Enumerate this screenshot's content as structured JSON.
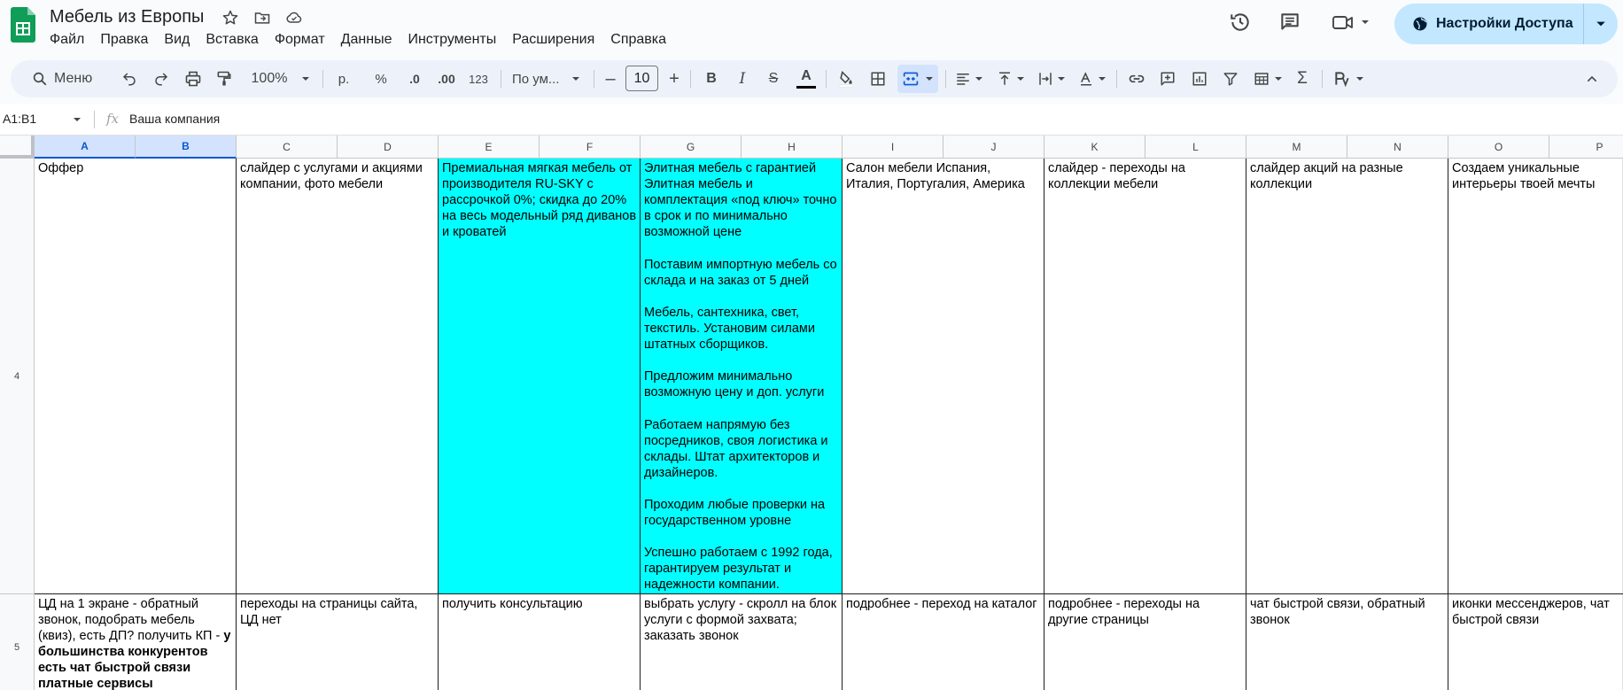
{
  "app": {
    "title": "Мебель из Европы",
    "menu": [
      "Файл",
      "Правка",
      "Вид",
      "Вставка",
      "Формат",
      "Данные",
      "Инструменты",
      "Расширения",
      "Справка"
    ],
    "share_label": "Настройки Доступа"
  },
  "toolbar": {
    "search_label": "Меню",
    "zoom": "100%",
    "currency": "р.",
    "percent": "%",
    "dec_decrease": ".0",
    "dec_increase": ".00",
    "number_format": "123",
    "font_name": "По ум...",
    "font_size": "10",
    "minus": "–",
    "plus": "+",
    "bold": "B",
    "italic": "I",
    "strike": "S",
    "text_color_letter": "A",
    "sum": "Σ"
  },
  "formula_bar": {
    "name_box": "A1:B1",
    "fx": "fx",
    "content": "Ваша компания"
  },
  "colors": {
    "highlight_cyan": "#00ffff",
    "share_bg": "#c2e7ff",
    "selected_header": "#d3e3fd",
    "accent_blue": "#0b57d0",
    "sheets_green": "#0f9d58"
  },
  "columns": [
    "A",
    "B",
    "C",
    "D",
    "E",
    "F",
    "G",
    "H",
    "I",
    "J",
    "K",
    "L",
    "M",
    "N",
    "O",
    "P"
  ],
  "rows": [
    {
      "number": "4",
      "cells": [
        {
          "text": "Оффер",
          "bold_text": ""
        },
        {
          "text": "слайдер с услугами и акциями компании, фото мебели",
          "bold_text": ""
        },
        {
          "text": "Премиальная мягкая мебель от производителя RU-SKY с рассрочкой 0%; скидка до 20% на весь модельный ряд диванов и кроватей",
          "bold_text": ""
        },
        {
          "text": "Элитная мебель с гарантией\nЭлитная мебель и комплектация «под ключ» точно в срок и по минимально возможной цене\n\nПоставим импортную мебель со склада и на заказ от 5 дней\n\nМебель, сантехника, свет, текстиль. Установим силами штатных сборщиков.\n\nПредложим минимально возможную цену и доп. услуги\n\nРаботаем напрямую без посредников, своя логистика и склады. Штат архитекторов и дизайнеров.\n\nПроходим любые проверки на государственном уровне\n\nУспешно работаем с 1992 года, гарантируем результат и надежности компании.",
          "bold_text": ""
        },
        {
          "text": "Салон мебели Испания, Италия, Португалия, Америка",
          "bold_text": ""
        },
        {
          "text": "слайдер - переходы на коллекции мебели",
          "bold_text": ""
        },
        {
          "text": "слайдер акций на разные коллекции",
          "bold_text": ""
        },
        {
          "text": "Создаем уникальные интерьеры твоей мечты",
          "bold_text": ""
        }
      ]
    },
    {
      "number": "5",
      "cells": [
        {
          "text": "ЦД на 1 экране - обратный звонок, подобрать мебель (квиз), есть ДП? получить КП - ",
          "bold_text": "у большинства конкурентов есть чат быстрой связи\nплатные сервисы"
        },
        {
          "text": "переходы на страницы сайта, ЦД нет",
          "bold_text": ""
        },
        {
          "text": "получить консультацию",
          "bold_text": ""
        },
        {
          "text": "выбрать услугу - скролл на блок услуги с формой захвата; заказать звонок",
          "bold_text": ""
        },
        {
          "text": "подробнее - переход на каталог",
          "bold_text": ""
        },
        {
          "text": "подробнее - переходы на другие страницы",
          "bold_text": ""
        },
        {
          "text": "чат быстрой связи, обратный звонок",
          "bold_text": ""
        },
        {
          "text": "иконки мессенджеров, чат быстрой связи",
          "bold_text": ""
        }
      ]
    }
  ]
}
